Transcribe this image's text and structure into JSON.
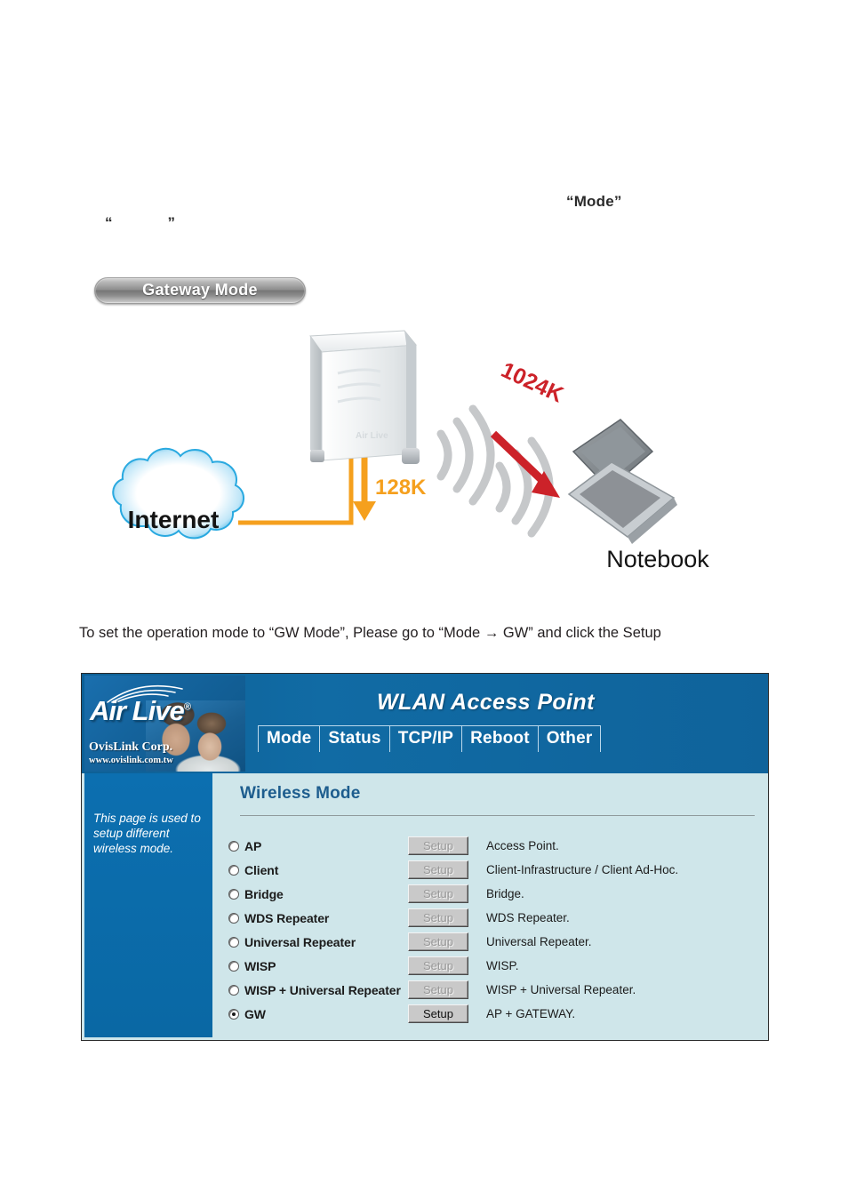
{
  "page": {
    "stray_mode_word": "“Mode”",
    "stray_empty_quote_open": "“",
    "stray_empty_quote_close": "”",
    "pill_label": "Gateway Mode",
    "instruction": "To set the operation mode to “GW Mode”, Please go to “Mode → GW” and click the Setup"
  },
  "diagram": {
    "internet_label": "Internet",
    "wan_speed_label": "128K",
    "wlan_speed_label": "1024K",
    "notebook_label": "Notebook",
    "colors": {
      "wan_link": "#F5A01E",
      "wlan_arrow": "#CC2229",
      "cloud_outline": "#29A9E0",
      "signal_arc": "#C6C8CA"
    }
  },
  "router_ui": {
    "brand": {
      "logo_word": "Air Live",
      "logo_registered": "®",
      "company": "OvisLink Corp.",
      "website": "www.ovislink.com.tw"
    },
    "title": "WLAN Access Point",
    "tabs": [
      {
        "label": "Mode"
      },
      {
        "label": "Status"
      },
      {
        "label": "TCP/IP"
      },
      {
        "label": "Reboot"
      },
      {
        "label": "Other"
      }
    ],
    "sidebar_note": "This page is used to setup different wireless mode.",
    "content_title": "Wireless Mode",
    "setup_button_label": "Setup",
    "modes": [
      {
        "label": "AP",
        "description": "Access Point.",
        "selected": false,
        "enabled": false
      },
      {
        "label": "Client",
        "description": "Client-Infrastructure / Client Ad-Hoc.",
        "selected": false,
        "enabled": false
      },
      {
        "label": "Bridge",
        "description": "Bridge.",
        "selected": false,
        "enabled": false
      },
      {
        "label": "WDS Repeater",
        "description": "WDS Repeater.",
        "selected": false,
        "enabled": false
      },
      {
        "label": "Universal Repeater",
        "description": "Universal Repeater.",
        "selected": false,
        "enabled": false
      },
      {
        "label": "WISP",
        "description": "WISP.",
        "selected": false,
        "enabled": false
      },
      {
        "label": "WISP + Universal Repeater",
        "description": "WISP + Universal Repeater.",
        "selected": false,
        "enabled": false
      },
      {
        "label": "GW",
        "description": "AP + GATEWAY.",
        "selected": true,
        "enabled": true
      }
    ],
    "colors": {
      "header_blue": "#0F639B",
      "sidebar_blue": "#0B6CAB",
      "content_bg": "#CFE6EA",
      "heading_blue": "#1D5D8E"
    }
  }
}
